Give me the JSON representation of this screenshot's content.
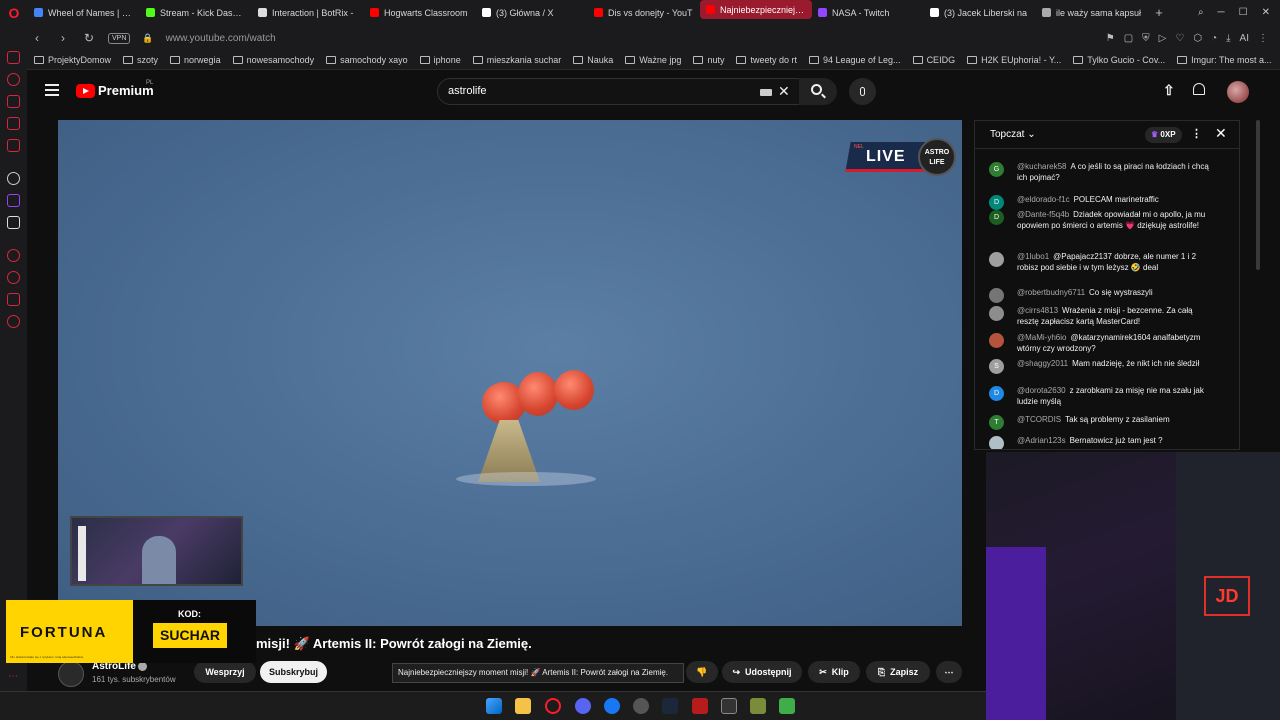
{
  "browser": {
    "tabs": [
      {
        "label": "Wheel of Names | Ran",
        "color": "#4285f4"
      },
      {
        "label": "Stream - Kick Dashbo",
        "color": "#53fc18"
      },
      {
        "label": "Interaction | BotRix -",
        "color": "#dddddd"
      },
      {
        "label": "Hogwarts Classroom",
        "color": "#ff0000"
      },
      {
        "label": "(3) Główna / X",
        "color": "#ffffff"
      },
      {
        "label": "Dis vs donejty - YouT",
        "color": "#ff0000"
      },
      {
        "label": "Najniebezpieczniejszy",
        "color": "#ff0000",
        "active": true
      },
      {
        "label": "NASA - Twitch",
        "color": "#9146ff"
      },
      {
        "label": "(3) Jacek Liberski na",
        "color": "#ffffff"
      },
      {
        "label": "ile waży sama kapsuł",
        "color": "#aaaaaa"
      }
    ],
    "new_tab_label": "+",
    "vpn_label": "VPN",
    "url": "www.youtube.com/watch",
    "ai_label": "AI",
    "bookmarks": [
      "ProjektyDomow",
      "szoty",
      "norwegia",
      "nowesamochody",
      "samochody xayo",
      "iphone",
      "mieszkania suchar",
      "Nauka",
      "Ważne jpg",
      "nuty",
      "tweety do rt",
      "94 League of Leg...",
      "CEIDG",
      "H2K EUphoria! - Y...",
      "Tylko Gucio - Cov...",
      "Imgur: The most a..."
    ]
  },
  "youtube": {
    "brand": "Premium",
    "region": "PL",
    "search_value": "astrolife",
    "video": {
      "live_label": "LIVE",
      "live_small": "NEL",
      "logo_text": "ASTRO LIFE",
      "title": "misji! 🚀 Artemis II: Powrót załogi na Ziemię.",
      "tooltip": "Najniebezpieczniejszy moment misji! 🚀 Artemis II: Powrót załogi na Ziemię."
    },
    "channel": {
      "name": "AstroLife",
      "subscribers": "161 tys. subskrybentów",
      "support_label": "Wesprzyj",
      "subscribe_label": "Subskrybuj"
    },
    "actions": {
      "share_label": "Udostępnij",
      "clip_label": "Klip",
      "save_label": "Zapisz",
      "more_label": "⋯"
    },
    "chat": {
      "mode_label": "Topczat",
      "xp_label": "0XP",
      "messages": [
        {
          "author": "@kucharek58",
          "text": "A co jeśli to są piraci na łodziach i chcą ich pojmać?",
          "initial": "G",
          "color": "#2e7d32"
        },
        {
          "author": "@eldorado-f1c",
          "text": "POLECAM marinetraffic",
          "initial": "D",
          "color": "#00897b"
        },
        {
          "author": "@Dante-f5q4b",
          "text": "Dziadek opowiadał mi o apollo, ja mu opowiem po śmierci o artemis 💗 dziękuję astrolife!",
          "initial": "D",
          "color": "#1b5e20"
        },
        {
          "author": "@1lubo1",
          "text": "@Papajacz2137 dobrze, ale numer 1 i 2 robisz pod siebie i w tym leżysz 🤣 deal",
          "initial": "",
          "color": "#9e9e9e"
        },
        {
          "author": "@robertbudny6711",
          "text": "Co się wystraszyli",
          "initial": "",
          "color": "#757575"
        },
        {
          "author": "@cirrs4813",
          "text": "Wrażenia z misji - bezcenne. Za całą resztę zapłacisz kartą MasterCard!",
          "initial": "",
          "color": "#8d8d8d"
        },
        {
          "author": "@MaMi-yh6io",
          "text": "@katarzynamirek1604 analfabetyzm wtórny czy wrodzony?",
          "initial": "",
          "color": "#b5533c"
        },
        {
          "author": "@shaggy2011",
          "text": "Mam nadzieję, że nikt ich nie śledził",
          "initial": "S",
          "color": "#9e9e9e"
        },
        {
          "author": "@dorota2630",
          "text": "z zarobkami za misję nie ma szału jak ludzie myślą",
          "initial": "D",
          "color": "#1e88e5"
        },
        {
          "author": "@TCORDIS",
          "text": "Tak są problemy z zasilaniem",
          "initial": "T",
          "color": "#2e7d32"
        },
        {
          "author": "@Adrian123s",
          "text": "Bernatowicz już tam jest ?",
          "initial": "",
          "color": "#b0bec5"
        }
      ]
    }
  },
  "ad": {
    "brand": "FORTUNA",
    "code_label": "KOD:",
    "code": "SUCHAR",
    "fine_print": "18+ Hazard wiąże się z ryzykiem. Graj odpowiedzialnie."
  },
  "webcam": {
    "neon_text": "JD"
  }
}
